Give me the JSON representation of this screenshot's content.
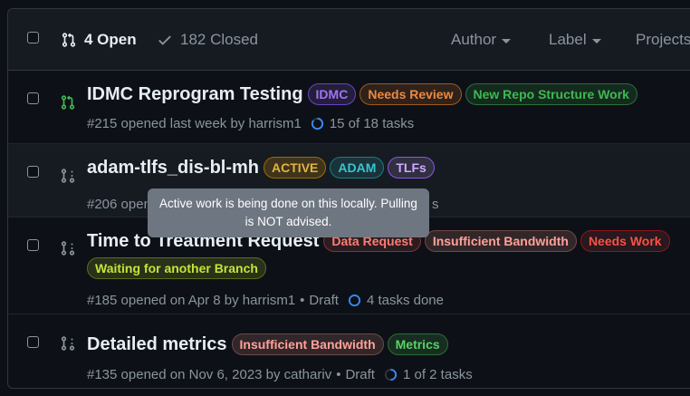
{
  "header": {
    "open_label": "4 Open",
    "closed_label": "182 Closed",
    "filters": [
      "Author",
      "Label",
      "Projects"
    ]
  },
  "issues": [
    {
      "title": "IDMC Reprogram Testing",
      "status": "open",
      "labels": [
        {
          "text": "IDMC",
          "color": "#a371f7"
        },
        {
          "text": "Needs Review",
          "color": "#f0883e"
        },
        {
          "text": "New Repo Structure Work",
          "color": "#3fb950"
        }
      ],
      "meta": "#215 opened last week by harrism1",
      "tasks": "15 of 18 tasks",
      "task_progress": 0.83
    },
    {
      "title": "adam-tlfs_dis-bl-mh",
      "status": "draft",
      "labels": [
        {
          "text": "ACTIVE",
          "color": "#e3b341"
        },
        {
          "text": "ADAM",
          "color": "#39c5cf"
        },
        {
          "text": "TLFs",
          "color": "#d2a8ff"
        }
      ],
      "meta_visible": "#206 open",
      "meta_tail": "s"
    },
    {
      "title": "Time to Treatment Request",
      "status": "draft",
      "labels": [
        {
          "text": "Data Request",
          "color": "#ff7b72"
        },
        {
          "text": "Insufficient Bandwidth",
          "color": "#ffa198"
        },
        {
          "text": "Needs Work",
          "color": "#f85149"
        },
        {
          "text": "Waiting for another Branch",
          "color": "#c6e535"
        }
      ],
      "meta": "#185 opened on Apr 8 by harrism1",
      "draft": "Draft",
      "tasks": "4 tasks done",
      "task_progress": 0
    },
    {
      "title": "Detailed metrics",
      "status": "draft",
      "labels": [
        {
          "text": "Insufficient Bandwidth",
          "color": "#ffa198"
        },
        {
          "text": "Metrics",
          "color": "#56d364"
        }
      ],
      "meta": "#135 opened on Nov 6, 2023 by cathariv",
      "draft": "Draft",
      "tasks": "1 of 2 tasks",
      "task_progress": 0.5
    }
  ],
  "tooltip": {
    "line1": "Active work is being done on this locally. Pulling",
    "line2": "is NOT advised."
  }
}
